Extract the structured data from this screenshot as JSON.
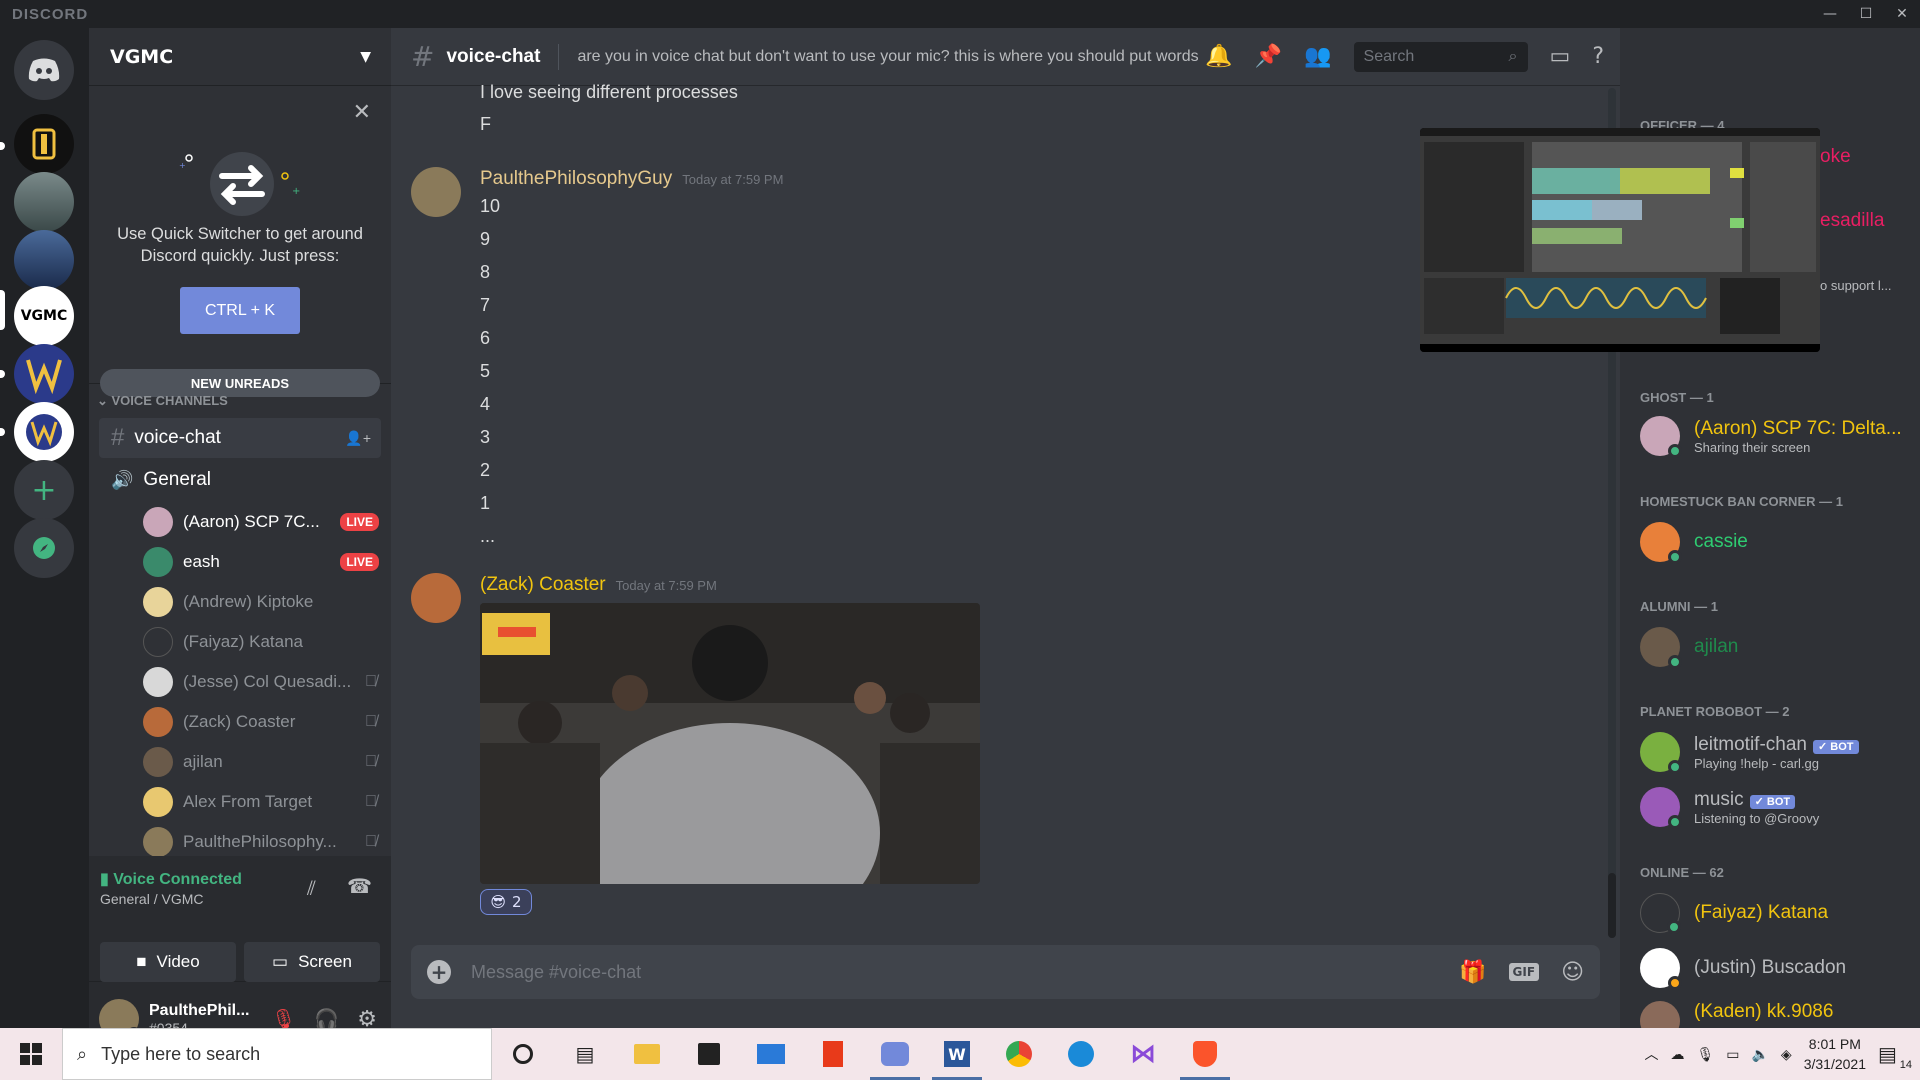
{
  "app": {
    "brand": "DISCORD"
  },
  "server": {
    "name": "VGMC"
  },
  "quick_switcher": {
    "line1": "Use Quick Switcher to get around",
    "line2": "Discord quickly. Just press:",
    "button": "CTRL + K"
  },
  "new_unreads": "NEW UNREADS",
  "voice_category": "VOICE CHANNELS",
  "channels": {
    "voice_chat": "voice-chat",
    "general": "General"
  },
  "voice_users": [
    {
      "name": "(Aaron) SCP 7C...",
      "live": "LIVE",
      "color": "#c9a6b8"
    },
    {
      "name": "eash",
      "live": "LIVE",
      "color": "#3a8a6b"
    },
    {
      "name": "(Andrew) Kiptoke",
      "color": "#e8d49a"
    },
    {
      "name": "(Faiyaz) Katana",
      "color": "#555"
    },
    {
      "name": "(Jesse) Col Quesadi...",
      "color": "#d8d8d8"
    },
    {
      "name": "(Zack) Coaster",
      "color": "#b86a3a"
    },
    {
      "name": "ajilan",
      "color": "#6a5a4a"
    },
    {
      "name": "Alex From Target",
      "color": "#e8c870"
    },
    {
      "name": "PaulthePhilosophy...",
      "color": "#8a7a5a"
    }
  ],
  "voice_panel": {
    "status": "Voice Connected",
    "location": "General / VGMC",
    "video": "Video",
    "screen": "Screen"
  },
  "user_panel": {
    "name": "PaulthePhil...",
    "tag": "#0354"
  },
  "topbar": {
    "channel": "voice-chat",
    "topic": "are you in voice chat but don't want to use your mic? this is where you should put words",
    "search_placeholder": "Search"
  },
  "messages": {
    "prev_lines": [
      "I love seeing different processes",
      "F"
    ],
    "msg1": {
      "author": "PaulthePhilosophyGuy",
      "time": "Today at 7:59 PM",
      "author_color": "#e6c98d",
      "lines": [
        "10",
        "9",
        "8",
        "7",
        "6",
        "5",
        "4",
        "3",
        "2",
        "1",
        "..."
      ]
    },
    "msg2": {
      "author": "(Zack) Coaster",
      "time": "Today at 7:59 PM",
      "author_color": "#f1c40f",
      "reaction_count": "2"
    }
  },
  "input": {
    "placeholder": "Message #voice-chat"
  },
  "members": {
    "officer_header": "OFFICER — 4",
    "officer_partials": [
      "oke",
      "esadilla",
      "o support l..."
    ],
    "groups": [
      {
        "header": "GHOST — 1",
        "name": "(Aaron) SCP 7C: Delta...",
        "sub": "Sharing their screen",
        "color": "#f1c40f"
      },
      {
        "header": "HOMESTUCK BAN CORNER — 1",
        "name": "cassie",
        "color": "#2ecc71"
      },
      {
        "header": "ALUMNI — 1",
        "name": "ajilan",
        "color": "#1f8b4c"
      },
      {
        "header": "PLANET ROBOBOT — 2",
        "name": "leitmotif-chan",
        "sub": "Playing !help - carl.gg",
        "bot": "✓ BOT",
        "color": "#b9bbbe"
      },
      {
        "name": "music",
        "sub": "Listening to @Groovy",
        "bot": "✓ BOT",
        "color": "#b9bbbe"
      },
      {
        "header": "ONLINE — 62",
        "name": "(Faiyaz) Katana",
        "color": "#f1c40f"
      },
      {
        "name": "(Justin) Buscadon",
        "color": "#b9bbbe"
      },
      {
        "name": "(Kaden) kk.9086",
        "color": "#f1c40f"
      }
    ]
  },
  "taskbar": {
    "search": "Type here to search",
    "time": "8:01 PM",
    "date": "3/31/2021",
    "notif": "14"
  }
}
